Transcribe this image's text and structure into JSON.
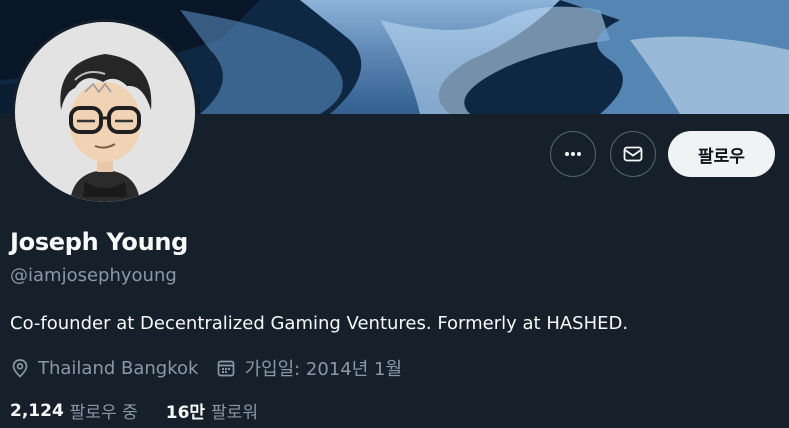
{
  "profile": {
    "name": "Joseph Young",
    "handle": "@iamjosephyoung",
    "bio": "Co-founder at Decentralized Gaming Ventures. Formerly at HASHED.",
    "location": "Thailand Bangkok",
    "joined": "가입일: 2014년 1월"
  },
  "actions": {
    "follow_label": "팔로우",
    "more_icon": "more-horizontal-icon",
    "message_icon": "envelope-icon"
  },
  "stats": {
    "following_count": "2,124",
    "following_label": "팔로우 중",
    "followers_count": "16만",
    "followers_label": "팔로워"
  },
  "colors": {
    "background": "#15202b",
    "secondary_text": "#8b98a5",
    "follow_button_bg": "#eff3f4"
  }
}
